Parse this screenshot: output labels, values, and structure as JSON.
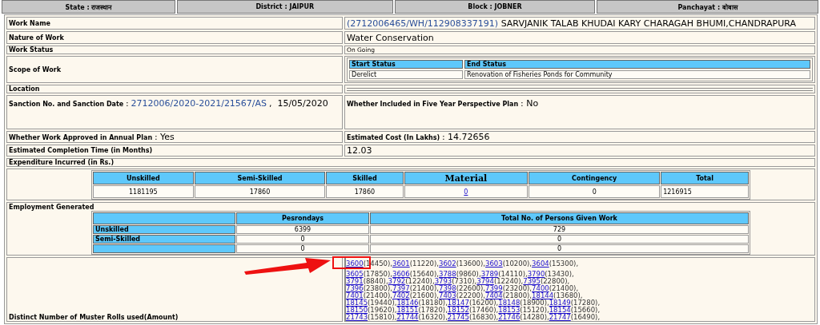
{
  "header": [
    "State : राजस्थान",
    "District : JAIPUR",
    "Block : JOBNER",
    "Panchayat : बोबास"
  ],
  "work_name": {
    "label": "Work Name",
    "code": "(2712006465/WH/112908337191)",
    "title": "SARVJANIK TALAB KHUDAI KARY CHARAGAH BHUMI,CHANDRAPURA"
  },
  "nature_of_work": {
    "label": "Nature of Work",
    "value": "Water Conservation"
  },
  "work_status": {
    "label": "Work Status",
    "value": "On Going"
  },
  "scope_of_work": {
    "label": "Scope of Work",
    "columns": [
      "Start Status",
      "End Status"
    ],
    "values": [
      "Derelict",
      "Renovation of Fisheries Ponds for Community"
    ]
  },
  "location": {
    "label": "Location"
  },
  "sanction": {
    "label": "Sanction No. and Sanction Date",
    "separator": ":",
    "number": "2712006/2020-2021/21567/AS",
    "date": ",  15/05/2020"
  },
  "five_year_plan": {
    "label": "Whether Included in Five Year Perspective Plan",
    "value": ": No"
  },
  "annual_plan": {
    "label": "Whether Work Approved in Annual Plan",
    "value": ": Yes"
  },
  "estimated_cost": {
    "label": "Estimated Cost (In Lakhs)",
    "value": ": 14.72656"
  },
  "completion_time": {
    "label": "Estimated Completion Time (in Months)",
    "value": "12.03"
  },
  "expenditure": {
    "label": "Expenditure Incurred (in Rs.)",
    "columns": [
      {
        "label": "Unskilled",
        "kind": "plain"
      },
      {
        "label": "Semi-Skilled",
        "kind": "plain"
      },
      {
        "label": "Skilled",
        "kind": "plain"
      },
      {
        "label": "Material",
        "kind": "serif"
      },
      {
        "label": "Contingency",
        "kind": "plain"
      },
      {
        "label": "Total",
        "kind": "plain"
      }
    ],
    "values": [
      {
        "text": "1181195",
        "kind": "plain"
      },
      {
        "text": "17860",
        "kind": "plain"
      },
      {
        "text": "17860",
        "kind": "plain"
      },
      {
        "text": "0",
        "kind": "link"
      },
      {
        "text": "0",
        "kind": "plain"
      },
      {
        "text": "1216915",
        "kind": "left"
      }
    ]
  },
  "employment": {
    "label": "Employment Generated",
    "columns": [
      "Pesrondays",
      "Total No. of Persons Given Work"
    ],
    "rows": [
      {
        "label": "Unskilled",
        "persondays": "6399",
        "persons": "729"
      },
      {
        "label": "Semi-Skilled",
        "persondays": "0",
        "persons": "0"
      },
      {
        "persondays": "0",
        "persons": "0"
      }
    ]
  },
  "muster_rolls": {
    "label": "Distinct Number of Muster Rolls used(Amount)",
    "lines": [
      [
        {
          "roll": "3600",
          "amount": "(14450),"
        },
        {
          "roll": "3601",
          "amount": "(11220),"
        },
        {
          "roll": "3602",
          "amount": "(13600),"
        },
        {
          "roll": "3603",
          "amount": "(10200),"
        },
        {
          "roll": "3604",
          "amount": "(15300),"
        }
      ],
      [
        {
          "roll": "3605",
          "amount": "(17850),"
        },
        {
          "roll": "3606",
          "amount": "(15640),"
        },
        {
          "roll": "3788",
          "amount": "(9860),"
        },
        {
          "roll": "3789",
          "amount": "(14110),"
        },
        {
          "roll": "3790",
          "amount": "(13430),"
        }
      ],
      [
        {
          "roll": "3791",
          "amount": "(8840),"
        },
        {
          "roll": "3792",
          "amount": "(12240),"
        },
        {
          "roll": "3793",
          "amount": "(7310),"
        },
        {
          "roll": "3794",
          "amount": "(12240),"
        },
        {
          "roll": "7395",
          "amount": "(22800),"
        }
      ],
      [
        {
          "roll": "7396",
          "amount": "(23800),"
        },
        {
          "roll": "7397",
          "amount": "(21400),"
        },
        {
          "roll": "7398",
          "amount": "(22600),"
        },
        {
          "roll": "7399",
          "amount": "(23200),"
        },
        {
          "roll": "7400",
          "amount": "(21400),"
        }
      ],
      [
        {
          "roll": "7401",
          "amount": "(21400),"
        },
        {
          "roll": "7402",
          "amount": "(21600),"
        },
        {
          "roll": "7403",
          "amount": "(22200),"
        },
        {
          "roll": "7404",
          "amount": "(21800),"
        },
        {
          "roll": "18144",
          "amount": "(13680),"
        }
      ],
      [
        {
          "roll": "18145",
          "amount": "(19440),"
        },
        {
          "roll": "18146",
          "amount": "(18180),"
        },
        {
          "roll": "18147",
          "amount": "(16200),"
        },
        {
          "roll": "18148",
          "amount": "(18900),"
        },
        {
          "roll": "18149",
          "amount": "(17280),"
        }
      ],
      [
        {
          "roll": "18150",
          "amount": "(19620),"
        },
        {
          "roll": "18151",
          "amount": "(17820),"
        },
        {
          "roll": "18152",
          "amount": "(17460),"
        },
        {
          "roll": "18153",
          "amount": "(15120),"
        },
        {
          "roll": "18154",
          "amount": "(15660),"
        }
      ],
      [
        {
          "roll": "21743",
          "amount": "(15810),"
        },
        {
          "roll": "21744",
          "amount": "(16320),"
        },
        {
          "roll": "21745",
          "amount": "(16830),"
        },
        {
          "roll": "21746",
          "amount": "(14280),"
        },
        {
          "roll": "21747",
          "amount": "(16490),"
        }
      ]
    ]
  }
}
